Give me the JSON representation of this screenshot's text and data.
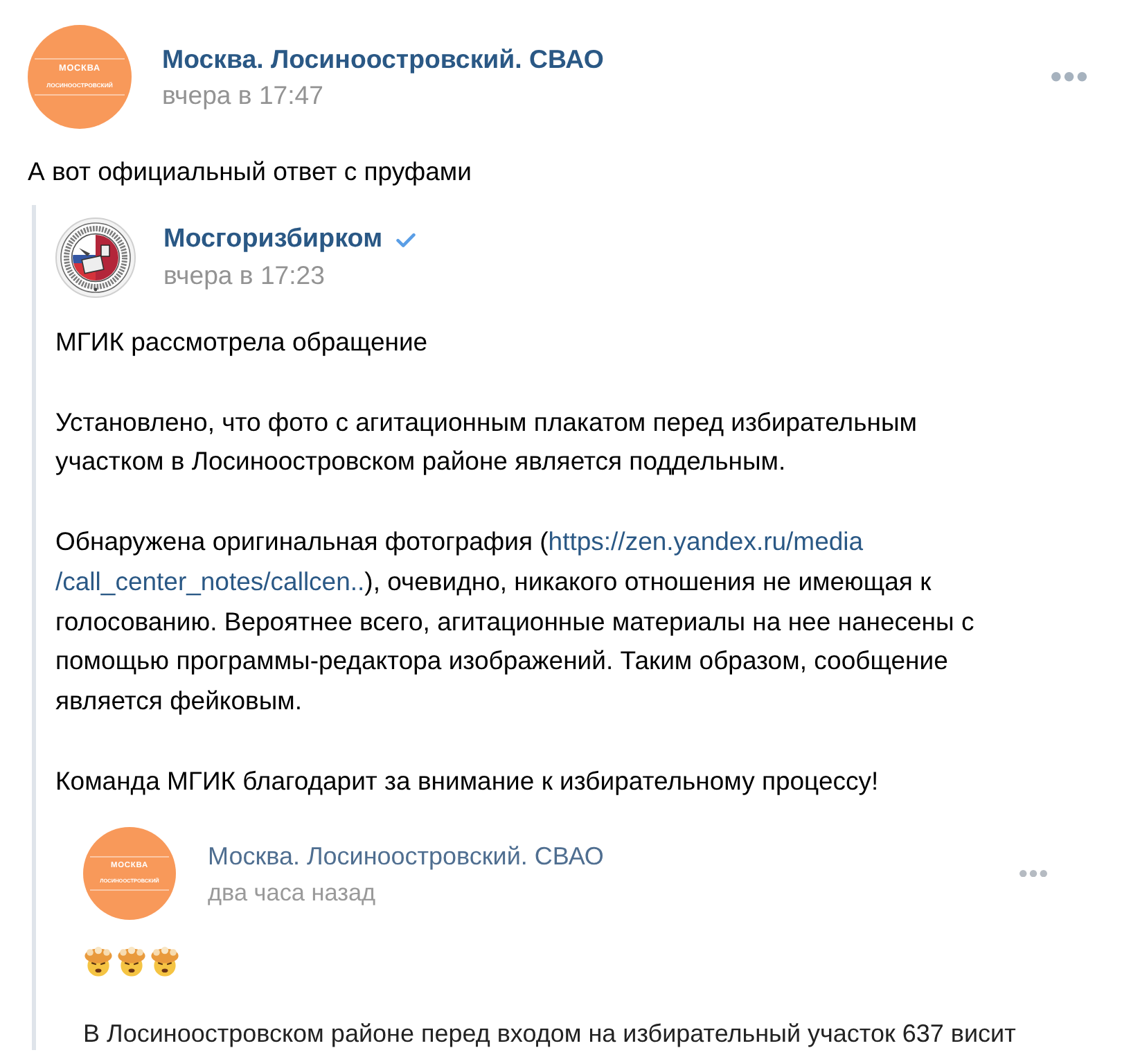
{
  "post": {
    "avatar": {
      "lines": [
        "МОСКВА",
        "ЛОСИНООСТРОВСКИЙ"
      ]
    },
    "author": "Москва. Лосиноостровский. СВАО",
    "time": "вчера в 17:47",
    "text": "А вот официальный ответ с пруфами"
  },
  "repost": {
    "author": "Мосгоризбирком",
    "verified": true,
    "time": "вчера в 17:23",
    "paragraphs": [
      {
        "parts": [
          {
            "kind": "text",
            "text": "МГИК рассмотрела обращение"
          }
        ]
      },
      {
        "parts": [
          {
            "kind": "text",
            "text": "Установлено, что фото с агитационным плакатом перед избирательным участком в Лосиноостровском районе является поддельным."
          }
        ]
      },
      {
        "parts": [
          {
            "kind": "text",
            "text": "Обнаружена оригинальная фотография ("
          },
          {
            "kind": "link",
            "text": "https://zen.yandex.ru/media"
          },
          {
            "kind": "link",
            "text": "/call_center_notes/callcen.."
          },
          {
            "kind": "text",
            "text": "), очевидно, никакого отношения не имеющая к голосованию. Вероятнее всего, агитационные материалы на нее нанесены с помощью программы-редактора изображений. Таким образом, сообщение является фейковым."
          }
        ]
      },
      {
        "parts": [
          {
            "kind": "text",
            "text": "Команда МГИК благодарит за внимание к избирательному процессу!"
          }
        ]
      }
    ],
    "screenshot": {
      "avatar": {
        "lines": [
          "МОСКВА",
          "ЛОСИНООСТРОВСКИЙ"
        ]
      },
      "author": "Москва. Лосиноостровский. СВАО",
      "time": "два часа назад",
      "emojis": [
        {
          "kind": "exploding-head"
        },
        {
          "kind": "exploding-head"
        },
        {
          "kind": "exploding-head"
        }
      ],
      "text": "В Лосиноостровском районе перед входом на избирательный участок 637 висит"
    }
  }
}
